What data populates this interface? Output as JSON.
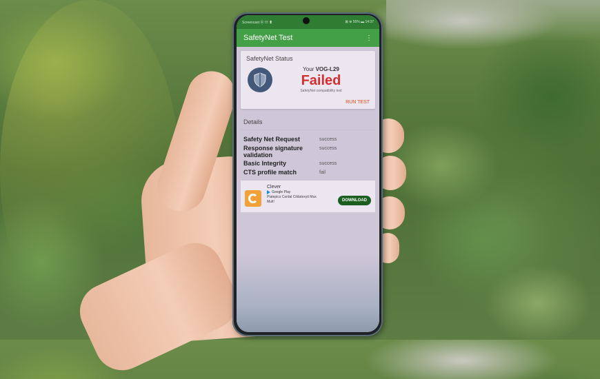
{
  "status_bar": {
    "left": "Screencast ⦿ ☏ ⬆",
    "right": "⊠ ⊕ 55% ▬ 14:37"
  },
  "app": {
    "title": "SafetyNet Test",
    "menu_icon": "more-vert-icon"
  },
  "status_card": {
    "title": "SafetyNet Status",
    "device_prefix": "Your",
    "device_model": "VOG-L29",
    "result": "Failed",
    "caption": "SafetyNet compatibility test",
    "run_label": "RUN TEST",
    "result_color": "#d32f2f"
  },
  "details": {
    "title": "Details",
    "rows": [
      {
        "key": "Safety Net Request",
        "value": "success"
      },
      {
        "key": "Response signature validation",
        "value": "success"
      },
      {
        "key": "Basic Integrity",
        "value": "success"
      },
      {
        "key": "CTS profile match",
        "value": "fail"
      }
    ]
  },
  "ad": {
    "name": "Clever",
    "store": "Google Play",
    "text": "Platepics Cardal Cildatexyit Max Mult!",
    "button": "DOWNLOAD"
  }
}
